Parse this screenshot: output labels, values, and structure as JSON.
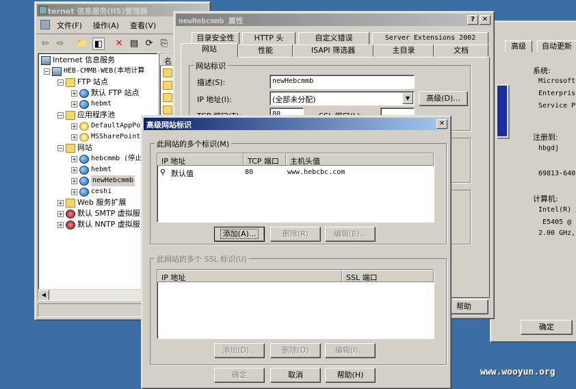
{
  "iis": {
    "title": "Internet 信息服务(IIS)管理器",
    "menu": [
      "文件(F)",
      "操作(A)",
      "查看(V)"
    ],
    "tree": {
      "root": "Internet 信息服务",
      "server": "HEB-CMMB-WEB(本地计算",
      "ftp": "FTP 站点",
      "ftp_default": "默认 FTP 站点",
      "ftp_hebmt": "hebmt",
      "apppools": "应用程序池",
      "pool1": "DefaultAppPo",
      "pool2": "MSSharePoint",
      "websites": "网站",
      "site1": "hebcmmb (停止",
      "site2": "hebmt",
      "site3": "newHebcmmb",
      "site4": "ceshi",
      "webext": "Web 服务扩展",
      "smtp": "默认 SMTP 虚拟服",
      "nntp": "默认 NNTP 虚拟服"
    },
    "list_header": "名"
  },
  "props": {
    "title": "newHebcmmb 属性",
    "tabs_back": [
      "目录安全性",
      "HTTP 头",
      "自定义错误",
      "Server Extensions 2002"
    ],
    "tabs_front": [
      "网站",
      "性能",
      "ISAPI 筛选器",
      "主目录",
      "文档"
    ],
    "group_label": "网站标识",
    "desc_label": "描述(S):",
    "desc_value": "newHebcmmb",
    "ip_label": "IP 地址(I):",
    "ip_value": "(全部未分配)",
    "advanced_btn": "高级(D)...",
    "tcp_label": "TCP 端口(T):",
    "tcp_value": "80",
    "ssl_label": "SSL 端口(L):",
    "help_btn": "帮助"
  },
  "sysprops": {
    "tabs": [
      "高级",
      "自动更新"
    ],
    "system_label": "系统:",
    "system_lines": [
      "Microsoft",
      "Enterpris",
      "Service P"
    ],
    "registered_label": "注册到:",
    "registered_user": "hbgdj",
    "product_id": "69813-640",
    "computer_label": "计算机:",
    "computer_lines": [
      "Intel(R) X",
      "E5405  @",
      "2.00 GHz,"
    ],
    "ok_btn": "确定"
  },
  "adv": {
    "title": "高级网站标识",
    "group1_label": "此网站的多个标识(M)",
    "cols": [
      "IP 地址",
      "TCP 端口",
      "主机头值"
    ],
    "rows": [
      {
        "ip": "默认值",
        "port": "80",
        "host": "www.hebcbc.com"
      }
    ],
    "add_btn": "添加(A)...",
    "remove_btn": "删除(R)",
    "edit_btn": "编辑(E)...",
    "group2_label": "此网站的多个 SSL 标识(U)",
    "ssl_cols": [
      "IP 地址",
      "SSL 端口"
    ],
    "add2_btn": "添加(D)...",
    "remove2_btn": "删除(O)",
    "edit2_btn": "编辑(I)...",
    "ok_btn": "确定",
    "cancel_btn": "取消",
    "help_btn": "帮助(H)"
  },
  "watermark": "www.wooyun.org"
}
